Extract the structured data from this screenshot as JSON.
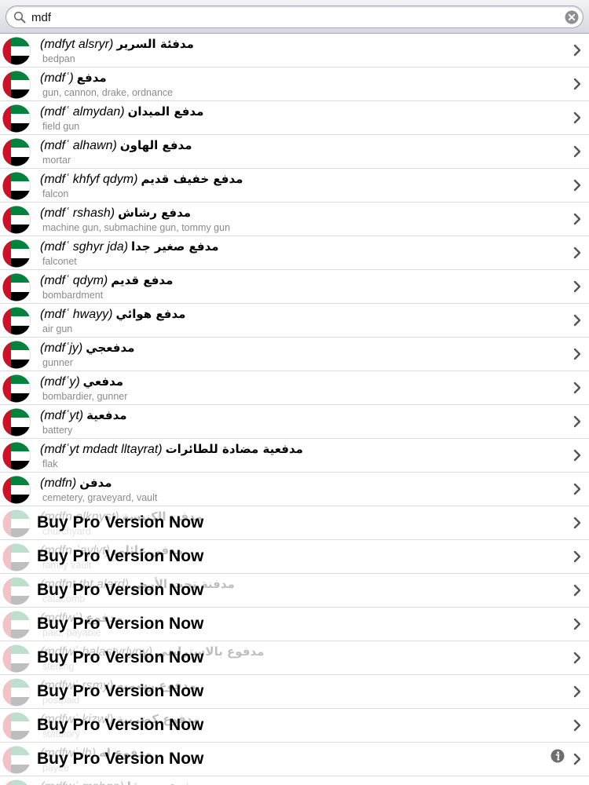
{
  "search": {
    "value": "mdf"
  },
  "entries": [
    {
      "translit": "(mdfyt alsryr)",
      "arabic": "مدفئة السرير",
      "meaning": "bedpan"
    },
    {
      "translit": "(mdfʿ)",
      "arabic": "مدفع",
      "meaning": "gun, cannon, drake, ordnance"
    },
    {
      "translit": "(mdfʿ almydan)",
      "arabic": "مدفع الميدان",
      "meaning": "field gun"
    },
    {
      "translit": "(mdfʿ alhawn)",
      "arabic": "مدفع الهاون",
      "meaning": "mortar"
    },
    {
      "translit": "(mdfʿ khfyf qdym)",
      "arabic": "مدفع خفيف قديم",
      "meaning": "falcon"
    },
    {
      "translit": "(mdfʿ rshash)",
      "arabic": "مدفع رشاش",
      "meaning": "machine gun, submachine gun, tommy gun"
    },
    {
      "translit": "(mdfʿ sghyr jda)",
      "arabic": "مدفع صغير جدا",
      "meaning": "falconet"
    },
    {
      "translit": "(mdfʿ qdym)",
      "arabic": "مدفع قديم",
      "meaning": "bombardment"
    },
    {
      "translit": "(mdfʿ hwayy)",
      "arabic": "مدفع هوائي",
      "meaning": "air gun"
    },
    {
      "translit": "(mdfʿjy)",
      "arabic": "مدفعجي",
      "meaning": "gunner"
    },
    {
      "translit": "(mdfʿy)",
      "arabic": "مدفعي",
      "meaning": "bombardier, gunner"
    },
    {
      "translit": "(mdfʿyt)",
      "arabic": "مدفعية",
      "meaning": "battery"
    },
    {
      "translit": "(mdfʿyt mdadt lltayrat)",
      "arabic": "مدفعية مضادة للطائرات",
      "meaning": "flak"
    },
    {
      "translit": "(mdfn)",
      "arabic": "مدفن",
      "meaning": "cemetery, graveyard, vault"
    }
  ],
  "locked": [
    {
      "translit": "(mdfn alknyst)",
      "arabic": "مدفن الكنيسة",
      "meaning": "churchyard"
    },
    {
      "translit": "(mdfn ʿaylyt)",
      "arabic": "مدفن عائلي",
      "meaning": "family vault"
    },
    {
      "translit": "(mdfnt tht alard)",
      "arabic": "مدفنة تحت الأرض",
      "meaning": "catacomb"
    },
    {
      "translit": "(mdfwʿ)",
      "arabic": "مدفوع",
      "meaning": "paid, payable"
    },
    {
      "translit": "(mdfwʿ balastyrlyny)",
      "arabic": "مدفوع بالاسترليني",
      "meaning": "sterling"
    },
    {
      "translit": "(mdfwʿ rsmy)",
      "arabic": "مدفوع رسميه",
      "meaning": "postpaid"
    },
    {
      "translit": "(mdfwʿ kizwl)",
      "arabic": "مدفوع كضريبة",
      "meaning": "statutory"
    },
    {
      "translit": "(mdfwʿ lh)",
      "arabic": "مدفوع له",
      "meaning": "payee"
    },
    {
      "translit": "(mdfwʿ msbqa)",
      "arabic": "مدفوع مسبقا",
      "meaning": "prepaid"
    }
  ],
  "buy_pro_label": "Buy Pro Version Now",
  "icons": {
    "flag": "uae-flag-icon",
    "chevron": "chevron-right-icon",
    "search": "search-icon",
    "clear": "clear-icon",
    "info": "info-icon"
  },
  "colors": {
    "flag_red": "#ce1126",
    "flag_green": "#00843d",
    "flag_black": "#000000",
    "chevron": "#555555"
  }
}
